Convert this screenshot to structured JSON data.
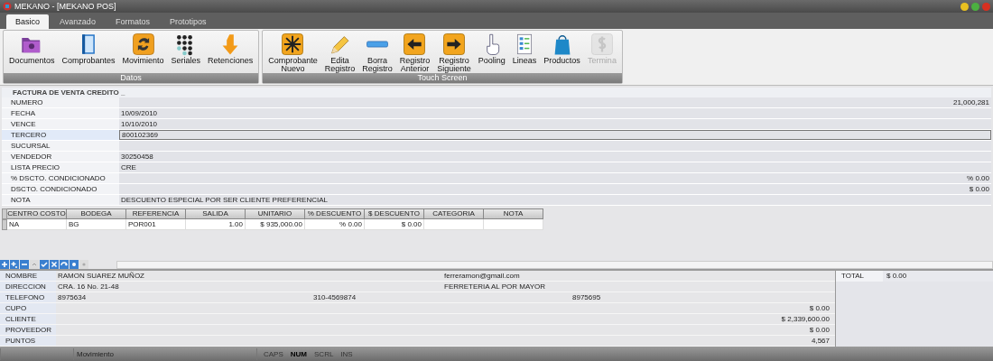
{
  "window": {
    "title": "MEKANO - [MEKANO POS]"
  },
  "tabs": [
    {
      "label": "Basico",
      "selected": true
    },
    {
      "label": "Avanzado",
      "selected": false
    },
    {
      "label": "Formatos",
      "selected": false
    },
    {
      "label": "Prototipos",
      "selected": false
    }
  ],
  "ribbon": {
    "groups": [
      {
        "label": "Datos",
        "buttons": [
          {
            "label": "Documentos",
            "disabled": false
          },
          {
            "label": "Comprobantes",
            "disabled": false
          },
          {
            "label": "Movimiento",
            "disabled": false
          },
          {
            "label": "Seriales",
            "disabled": false
          },
          {
            "label": "Retenciones",
            "disabled": false
          }
        ]
      },
      {
        "label": "Touch Screen",
        "buttons": [
          {
            "label": "Comprobante Nuevo",
            "disabled": false
          },
          {
            "label": "Edita Registro",
            "disabled": false
          },
          {
            "label": "Borra Registro",
            "disabled": false
          },
          {
            "label": "Registro Anterior",
            "disabled": false
          },
          {
            "label": "Registro Siguiente",
            "disabled": false
          },
          {
            "label": "Pooling",
            "disabled": false
          },
          {
            "label": "Lineas",
            "disabled": false
          },
          {
            "label": "Productos",
            "disabled": false
          },
          {
            "label": "Termina",
            "disabled": true
          }
        ]
      }
    ]
  },
  "form": {
    "title": "FACTURA DE VENTA CREDITO _",
    "fields": [
      {
        "label": "NUMERO",
        "kind": "number",
        "value": "21,000,281",
        "focused": false
      },
      {
        "label": "FECHA",
        "kind": "text",
        "value": "10/09/2010",
        "focused": false
      },
      {
        "label": "VENCE",
        "kind": "text",
        "value": "10/10/2010",
        "focused": false
      },
      {
        "label": "TERCERO",
        "kind": "text",
        "value": "800102369",
        "focused": true
      },
      {
        "label": "SUCURSAL",
        "kind": "text",
        "focused": false
      },
      {
        "label": "VENDEDOR",
        "kind": "text",
        "value": "30250458",
        "focused": false
      },
      {
        "label": "LISTA PRECIO",
        "kind": "text",
        "value": "CRE",
        "focused": false
      },
      {
        "label": "% DSCTO. CONDICIONADO",
        "kind": "number",
        "value": "% 0.00",
        "focused": false
      },
      {
        "label": "DSCTO. CONDICIONADO",
        "kind": "number",
        "value": "$ 0.00",
        "focused": false
      },
      {
        "label": "NOTA",
        "kind": "text",
        "value": "DESCUENTO ESPECIAL POR SER CLIENTE PREFERENCIAL",
        "focused": false
      }
    ]
  },
  "grid": {
    "columns": [
      {
        "label": "CENTRO COSTO",
        "kind": "text"
      },
      {
        "label": "BODEGA",
        "kind": "text"
      },
      {
        "label": "REFERENCIA",
        "kind": "text"
      },
      {
        "label": "SALIDA",
        "kind": "number"
      },
      {
        "label": "UNITARIO",
        "kind": "number"
      },
      {
        "label": "% DESCUENTO",
        "kind": "number"
      },
      {
        "label": "$ DESCUENTO",
        "kind": "number"
      },
      {
        "label": "CATEGORIA",
        "kind": "text"
      },
      {
        "label": "NOTA",
        "kind": "text"
      }
    ],
    "rows": [
      {
        "cells": [
          "NA",
          "BG",
          "POR001",
          "1.00",
          "$ 935,000.00",
          "% 0.00",
          "$ 0.00"
        ]
      }
    ]
  },
  "customer": {
    "rows": [
      {
        "label": "NOMBRE",
        "column_1": "RAMON SUAREZ MUÑOZ",
        "column_3": "ferreramon@gmail.com"
      },
      {
        "label": "DIRECCION",
        "column_1": "CRA. 16 No. 21-48",
        "column_3": "FERRETERIA AL POR MAYOR"
      },
      {
        "label": "TELEFONO",
        "column_1": "8975634",
        "column_2": "310-4569874",
        "column_4": "8975695"
      },
      {
        "label": "CUPO",
        "amount": "$ 0.00"
      },
      {
        "label": "CLIENTE",
        "amount": "$ 2,339,600.00"
      },
      {
        "label": "PROVEEDOR",
        "amount": "$ 0.00"
      },
      {
        "label": "PUNTOS",
        "amount": "4,567"
      }
    ]
  },
  "total": {
    "label": "TOTAL",
    "value": "$ 0.00"
  },
  "status_bar": {
    "panels": [
      "Movimiento"
    ],
    "indicators": [
      {
        "label": "CAPS",
        "on": false
      },
      {
        "label": "NUM",
        "on": true
      },
      {
        "label": "SCRL",
        "on": false
      },
      {
        "label": "INS",
        "on": false
      }
    ]
  }
}
